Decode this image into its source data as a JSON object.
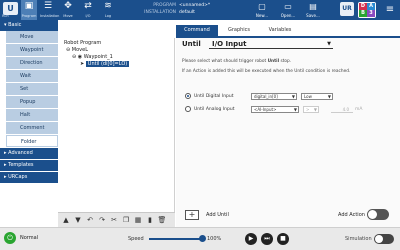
{
  "topbar": {
    "logo_text": "U",
    "logo_label": "Run",
    "buttons": [
      {
        "icon": "▣",
        "label": "Program"
      },
      {
        "icon": "☰",
        "label": "Installation"
      },
      {
        "icon": "✥",
        "label": "Move"
      },
      {
        "icon": "⇄",
        "label": "I/O"
      },
      {
        "icon": "≋",
        "label": "Log"
      }
    ],
    "file": {
      "program_key": "PROGRAM",
      "program_val": "<unnamed>*",
      "install_key": "INSTALLATION",
      "install_val": "default"
    },
    "file_buttons": [
      {
        "icon": "▢",
        "label": "New..."
      },
      {
        "icon": "▭",
        "label": "Open..."
      },
      {
        "icon": "▤",
        "label": "Save..."
      }
    ],
    "ur_logo": "UR",
    "dab": [
      "D",
      "A",
      "B",
      "3"
    ],
    "dab_colors": [
      "#d22e4f",
      "#2a8bd3",
      "#2aa531",
      "#8a4bc0"
    ],
    "menu_icon": "≡"
  },
  "sidebar": {
    "basic": "Basic",
    "items": [
      "Move",
      "Waypoint",
      "Direction",
      "Wait",
      "Set",
      "Popup",
      "Halt",
      "Comment",
      "Folder"
    ],
    "selected_index": 8,
    "groups": [
      "Advanced",
      "Templates",
      "URCaps"
    ]
  },
  "tree": {
    "root": "Robot Program",
    "lines": [
      "MoveL",
      "Waypoint_1",
      "Until (di[0]=LO)"
    ],
    "toolbar_icons": [
      "▲",
      "▼",
      "↶",
      "↷",
      "✂",
      "❐",
      "▦",
      "▮",
      "🗑"
    ]
  },
  "tabs": [
    "Command",
    "Graphics",
    "Variables"
  ],
  "command": {
    "title": "Until",
    "selected_type": "I/O Input",
    "desc1_pre": "Please select what should trigger robot ",
    "desc1_bold": "Until",
    "desc1_post": " stop.",
    "desc2": "If an Action is added this will be executed when the Until condition is reached.",
    "digital_label": "Until Digital Input",
    "digital_value": "digital_in[0]",
    "digital_level": "Low",
    "analog_label": "Until Analog Input",
    "analog_value": "<AI-Input>",
    "analog_op": ">",
    "analog_num": "4.0",
    "analog_unit": "mA",
    "add_until": "Add Until",
    "add_action": "Add Action"
  },
  "status": {
    "mode": "Normal",
    "speed_label": "Speed",
    "speed_value": "100%",
    "speed_fraction": 1.0,
    "simulation_label": "Simulation"
  }
}
